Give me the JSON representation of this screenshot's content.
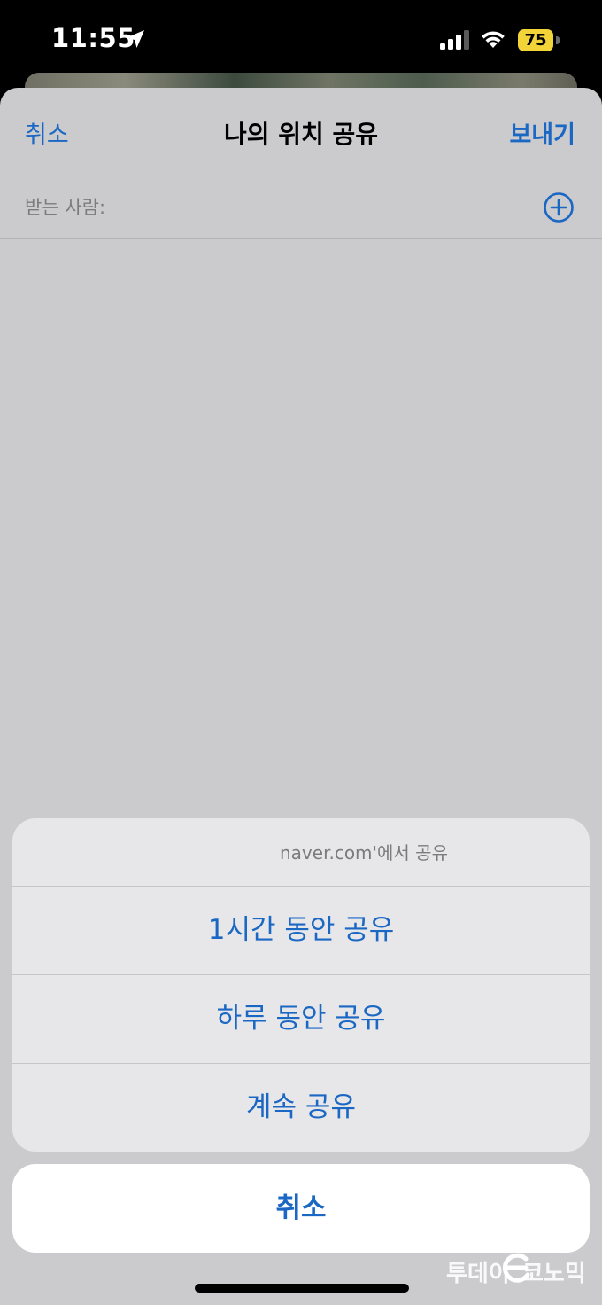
{
  "status_bar": {
    "time": "11:55",
    "battery_level": "75",
    "battery_color": "#f2d338"
  },
  "nav": {
    "cancel_label": "취소",
    "title": "나의 위치 공유",
    "send_label": "보내기"
  },
  "recipient": {
    "label": "받는 사람:",
    "add_icon": "plus-circle-icon"
  },
  "action_sheet": {
    "header": "naver.com'에서 공유",
    "options": [
      {
        "label": "1시간 동안 공유"
      },
      {
        "label": "하루 동안 공유"
      },
      {
        "label": "계속 공유"
      }
    ],
    "cancel_label": "취소"
  },
  "watermark": {
    "left_text": "투데이",
    "right_text": "코노믹"
  },
  "colors": {
    "accent": "#1a67c4",
    "sheet_background": "#cbcbcd",
    "action_background": "#e7e7e9"
  }
}
